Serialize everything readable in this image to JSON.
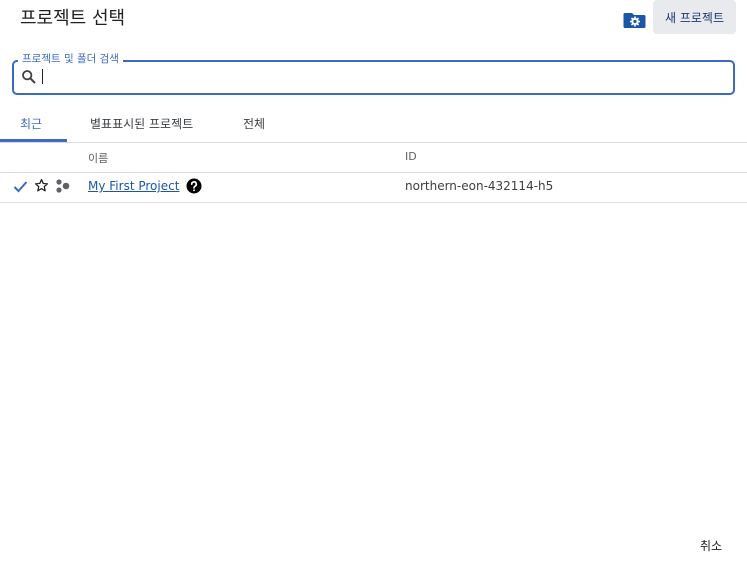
{
  "dialog": {
    "title": "프로젝트 선택",
    "new_project_label": "새 프로젝트",
    "manage_icon": "folder-gear-icon",
    "cancel_label": "취소"
  },
  "search": {
    "label": "프로젝트 및 폴더 검색",
    "value": "",
    "icon": "search-icon"
  },
  "tabs": [
    {
      "label": "최근",
      "active": true
    },
    {
      "label": "별표표시된 프로젝트",
      "active": false
    },
    {
      "label": "전체",
      "active": false
    }
  ],
  "table": {
    "columns": {
      "name": "이름",
      "id": "ID"
    },
    "rows": [
      {
        "selected": true,
        "name": "My First Project",
        "id": "northern-eon-432114-h5",
        "icons": [
          "check-icon",
          "star-outline-icon",
          "project-icon",
          "help-icon"
        ]
      }
    ]
  },
  "colors": {
    "accent": "#3b6ac2",
    "link": "#1a57a8",
    "button_bg": "#e8eaed"
  }
}
